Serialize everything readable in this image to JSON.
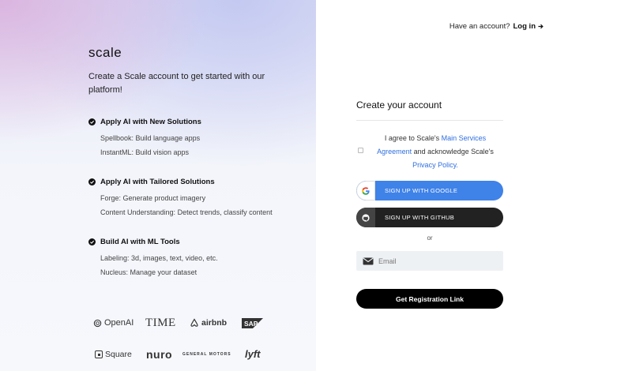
{
  "left": {
    "logo": "scale",
    "tagline": "Create a Scale account to get started with our platform!",
    "features": [
      {
        "title": "Apply AI with New Solutions",
        "items": [
          "Spellbook: Build language apps",
          "InstantML: Build vision apps"
        ]
      },
      {
        "title": "Apply AI with Tailored Solutions",
        "items": [
          "Forge: Generate product imagery",
          "Content Understanding: Detect trends, classify content"
        ]
      },
      {
        "title": "Build AI with ML Tools",
        "items": [
          "Labeling: 3d, images, text, video, etc.",
          "Nucleus: Manage your dataset"
        ]
      }
    ],
    "brands": {
      "openai": "OpenAI",
      "time": "TIME",
      "airbnb": "airbnb",
      "sap": "SAP",
      "square": "Square",
      "nuro": "nuro",
      "gm": "GENERAL MOTORS",
      "lyft": "lyft"
    }
  },
  "header": {
    "prompt": "Have an account?",
    "login": "Log in"
  },
  "form": {
    "title": "Create your account",
    "agree_prefix": "I agree to Scale's ",
    "agree_link1": "Main Services Agreement",
    "agree_mid": " and acknowledge Scale's ",
    "agree_link2": "Privacy Policy.",
    "google_label": "SIGN UP WITH GOOGLE",
    "github_label": "SIGN UP WITH GITHUB",
    "or": "or",
    "email_placeholder": "Email",
    "submit_label": "Get Registration Link"
  },
  "colors": {
    "accent": "#3f82e8",
    "link": "#2f6fe0",
    "dark": "#222222"
  }
}
